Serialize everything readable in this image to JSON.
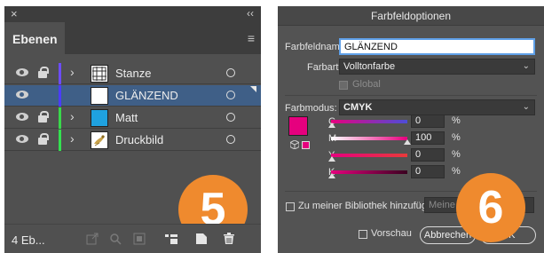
{
  "layers_panel": {
    "close_glyph": "×",
    "collapse_glyph": "‹‹",
    "tab_label": "Ebenen",
    "menu_glyph": "≡",
    "layers": [
      {
        "name": "Stanze",
        "color": "#6c4cff",
        "selected": false,
        "locked": true,
        "thumb": "grid"
      },
      {
        "name": "GLÄNZEND",
        "color": "#4b3cff",
        "selected": true,
        "locked": false,
        "thumb": "blank"
      },
      {
        "name": "Matt",
        "color": "#39d84a",
        "selected": false,
        "locked": true,
        "thumb": "blue"
      },
      {
        "name": "Druckbild",
        "color": "#34e050",
        "selected": false,
        "locked": true,
        "thumb": "bird"
      }
    ],
    "footer_count": "4 Eb...",
    "footer_icons": [
      "export-icon",
      "locate-icon",
      "clipping-mask-icon",
      "new-sublayer-icon",
      "new-layer-icon",
      "trash-icon"
    ],
    "badge_number": "5",
    "badge_color": "#ef8a2e"
  },
  "swatch_dialog": {
    "title": "Farbfeldoptionen",
    "name_label": "Farbfeldname:",
    "name_value": "GLÄNZEND",
    "type_label": "Farbart:",
    "type_value": "Volltonfarbe",
    "global_label": "Global",
    "mode_label": "Farbmodus:",
    "mode_value": "CMYK",
    "swatch_color": "#e6007e",
    "channels": [
      {
        "label": "C",
        "value": "0",
        "unit": "%"
      },
      {
        "label": "M",
        "value": "100",
        "unit": "%"
      },
      {
        "label": "Y",
        "value": "0",
        "unit": "%"
      },
      {
        "label": "K",
        "value": "0",
        "unit": "%"
      }
    ],
    "library_label": "Zu meiner Bibliothek hinzufügen",
    "library_select": "Meine Bi",
    "preview_label": "Vorschau",
    "cancel_label": "Abbrechen",
    "ok_label": "OK",
    "badge_number": "6",
    "badge_color": "#ef8a2e"
  }
}
